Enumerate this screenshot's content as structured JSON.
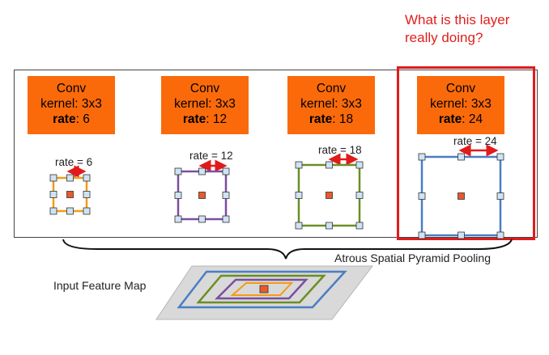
{
  "title_question": "What is this layer really doing?",
  "question_line1": "What is this layer",
  "question_line2": "really doing?",
  "colors": {
    "conv_fill": "#fb6a0a",
    "highlight": "#e01b1b",
    "kernel_6": "#f39c12",
    "kernel_12": "#7b4ea0",
    "kernel_18": "#6b8e23",
    "kernel_24": "#4a7ec2",
    "center_cell": "#e85a2c",
    "sample_cell": "#cfe3f5"
  },
  "conv_blocks": [
    {
      "title": "Conv",
      "kernel": "kernel: 3x3",
      "rate_word": "rate",
      "rate_value": ": 6"
    },
    {
      "title": "Conv",
      "kernel": "kernel: 3x3",
      "rate_word": "rate",
      "rate_value": ": 12"
    },
    {
      "title": "Conv",
      "kernel": "kernel: 3x3",
      "rate_word": "rate",
      "rate_value": ": 18"
    },
    {
      "title": "Conv",
      "kernel": "kernel: 3x3",
      "rate_word": "rate",
      "rate_value": ": 24"
    }
  ],
  "rate_labels": [
    "rate = 6",
    "rate = 12",
    "rate = 18",
    "rate = 24"
  ],
  "aspp_label": "Atrous Spatial Pyramid Pooling",
  "input_label": "Input Feature Map"
}
